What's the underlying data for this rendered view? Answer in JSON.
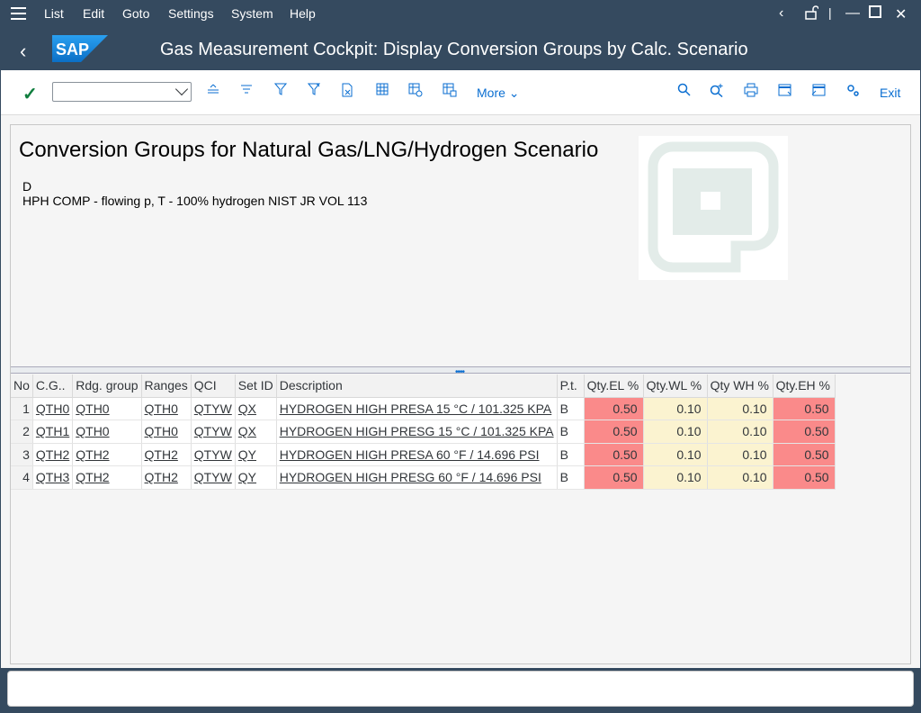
{
  "menu": {
    "items": [
      {
        "label": "List"
      },
      {
        "label": "Edit"
      },
      {
        "label": "Goto"
      },
      {
        "label": "Settings"
      },
      {
        "label": "System"
      },
      {
        "label": "Help"
      }
    ]
  },
  "title": {
    "logo_text": "SAP",
    "text": "Gas Measurement Cockpit: Display Conversion Groups by Calc. Scenario"
  },
  "toolbar": {
    "combo_value": "",
    "more_label": "More",
    "exit_label": "Exit"
  },
  "header": {
    "title": "Conversion Groups for Natural Gas/LNG/Hydrogen Scenario",
    "line1": "D",
    "line2": "HPH COMP - flowing p, T - 100% hydrogen NIST JR VOL 113"
  },
  "table": {
    "columns": [
      "No",
      "C.G..",
      "Rdg. group",
      "Ranges",
      "QCI",
      "Set ID",
      "Description",
      "P.t.",
      "Qty.EL %",
      "Qty.WL %",
      "Qty WH %",
      "Qty.EH %"
    ],
    "rows": [
      {
        "no": "1",
        "cg": "QTH0",
        "rdg": "QTH0",
        "ranges": "QTH0",
        "qci": "QTYW",
        "setid": "QX",
        "desc": "HYDROGEN HIGH PRESA 15 °C / 101.325 KPA",
        "pt": "B",
        "el": "0.50",
        "wl": "0.10",
        "wh": "0.10",
        "eh": "0.50"
      },
      {
        "no": "2",
        "cg": "QTH1",
        "rdg": "QTH0",
        "ranges": "QTH0",
        "qci": "QTYW",
        "setid": "QX",
        "desc": "HYDROGEN HIGH PRESG 15 °C / 101.325 KPA",
        "pt": "B",
        "el": "0.50",
        "wl": "0.10",
        "wh": "0.10",
        "eh": "0.50"
      },
      {
        "no": "3",
        "cg": "QTH2",
        "rdg": "QTH2",
        "ranges": "QTH2",
        "qci": "QTYW",
        "setid": "QY",
        "desc": "HYDROGEN HIGH PRESA 60 °F / 14.696 PSI",
        "pt": "B",
        "el": "0.50",
        "wl": "0.10",
        "wh": "0.10",
        "eh": "0.50"
      },
      {
        "no": "4",
        "cg": "QTH3",
        "rdg": "QTH2",
        "ranges": "QTH2",
        "qci": "QTYW",
        "setid": "QY",
        "desc": "HYDROGEN HIGH PRESG 60 °F / 14.696 PSI",
        "pt": "B",
        "el": "0.50",
        "wl": "0.10",
        "wh": "0.10",
        "eh": "0.50"
      }
    ]
  },
  "colors": {
    "shell": "#354a5f",
    "accent": "#0a6ed1",
    "limit_red": "#fa8a8a",
    "limit_yellow": "#fbf3d0"
  }
}
